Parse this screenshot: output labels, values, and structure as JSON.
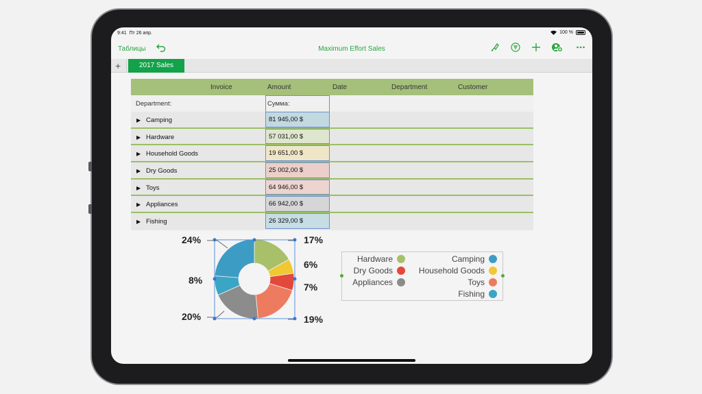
{
  "status": {
    "time": "9:41",
    "date": "Пт 26 апр.",
    "wifi_icon": "wifi-icon",
    "battery": "100 %"
  },
  "toolbar": {
    "back_label": "Таблицы",
    "undo_icon": "undo-icon",
    "title": "Maximum Effort Sales",
    "icons": [
      "brush-icon",
      "filter-icon",
      "plus-icon",
      "collaborate-icon",
      "more-icon"
    ]
  },
  "tabs": {
    "add_icon": "plus-icon",
    "sheets": [
      "2017 Sales"
    ]
  },
  "table": {
    "headers": [
      "Invoice",
      "Amount",
      "Date",
      "Department",
      "Customer"
    ],
    "group_label": "Department:",
    "sum_label": "Сумма:",
    "rows": [
      {
        "department": "Camping",
        "amount": "81 945,00 $",
        "color": "#c3d9e0"
      },
      {
        "department": "Hardware",
        "amount": "57 031,00 $",
        "color": "#dfe6cf"
      },
      {
        "department": "Household Goods",
        "amount": "19 651,00 $",
        "color": "#efe6c7"
      },
      {
        "department": "Dry Goods",
        "amount": "25 002,00 $",
        "color": "#eccfcb"
      },
      {
        "department": "Toys",
        "amount": "64 946,00 $",
        "color": "#eed4cf"
      },
      {
        "department": "Appliances",
        "amount": "66 942,00 $",
        "color": "#d6d6d6"
      },
      {
        "department": "Fishing",
        "amount": "26 329,00 $",
        "color": "#c6dde4"
      }
    ]
  },
  "chart_data": {
    "type": "pie",
    "categories": [
      "Hardware",
      "Household Goods",
      "Dry Goods",
      "Toys",
      "Appliances",
      "Fishing",
      "Camping"
    ],
    "values": [
      17,
      6,
      7,
      19,
      20,
      8,
      24
    ],
    "labels": [
      "17%",
      "6%",
      "7%",
      "19%",
      "20%",
      "8%",
      "24%"
    ],
    "colors": [
      "#a8c06a",
      "#f0c832",
      "#e4483a",
      "#ed7b5f",
      "#8c8c8c",
      "#3aa5c4",
      "#3d9cc3"
    ],
    "legend": [
      {
        "name": "Hardware",
        "color": "#a8c06a"
      },
      {
        "name": "Dry Goods",
        "color": "#e4483a"
      },
      {
        "name": "Appliances",
        "color": "#8c8c8c"
      },
      {
        "name": "Camping",
        "color": "#3d9cc3"
      },
      {
        "name": "Household Goods",
        "color": "#f0c832"
      },
      {
        "name": "Toys",
        "color": "#ed7b5f"
      },
      {
        "name": "Fishing",
        "color": "#3aa5c4"
      }
    ]
  }
}
